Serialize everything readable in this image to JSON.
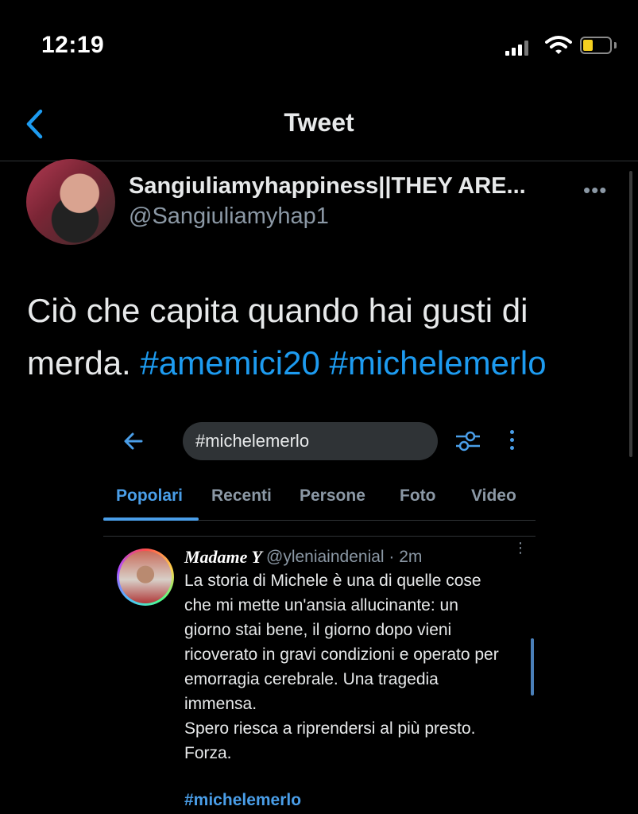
{
  "status_bar": {
    "time": "12:19",
    "battery_color": "#f5d020"
  },
  "nav": {
    "title": "Tweet",
    "back_icon": "chevron-left-icon"
  },
  "tweet": {
    "display_name": "Sangiuliamyhappiness||THEY ARE...",
    "handle": "@Sangiuliamyhap1",
    "more_label": "•••",
    "text_plain": "Ciò che capita quando hai gusti di merda. ",
    "hashtags": [
      "#amemici20",
      "#michelemerlo"
    ],
    "accent_color": "#1d9bf0"
  },
  "embedded_screenshot": {
    "search_value": "#michelemerlo",
    "tabs": [
      {
        "label": "Popolari",
        "active": true
      },
      {
        "label": "Recenti",
        "active": false
      },
      {
        "label": "Persone",
        "active": false
      },
      {
        "label": "Foto",
        "active": false
      },
      {
        "label": "Video",
        "active": false
      }
    ],
    "post": {
      "author": "Madame Y",
      "meta": "@yleniaindenial · 2m",
      "more_label": "⋮",
      "lines": [
        "La storia di Michele è una di quelle cose",
        "che mi mette un'ansia allucinante: un",
        "giorno stai bene, il giorno dopo vieni",
        "ricoverato in gravi condizioni e operato per",
        "emorragia cerebrale. Una tragedia",
        "immensa.",
        "Spero riesca a riprendersi al più presto.",
        "Forza."
      ],
      "hashtag": "#michelemerlo"
    }
  }
}
